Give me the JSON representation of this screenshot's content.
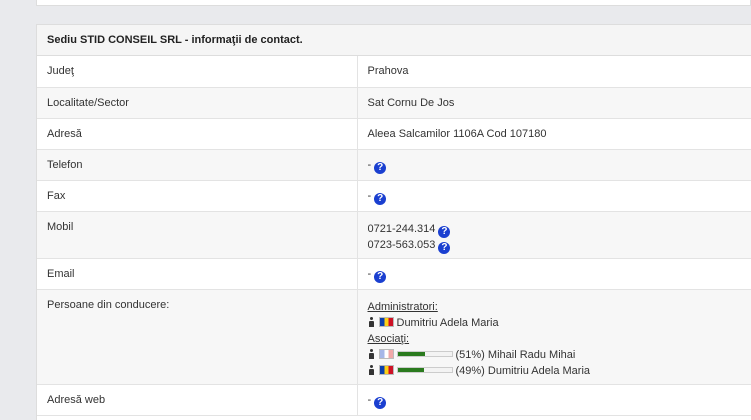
{
  "panel": {
    "title": "Sediu STID CONSEIL SRL - informaţii de contact."
  },
  "rows": {
    "judet": {
      "label": "Judeţ",
      "value": "Prahova"
    },
    "localitate": {
      "label": "Localitate/Sector",
      "value": "Sat Cornu De Jos"
    },
    "adresa": {
      "label": "Adresă",
      "value": "Aleea Salcamilor 1106A Cod 107180"
    },
    "telefon": {
      "label": "Telefon",
      "value": "-"
    },
    "fax": {
      "label": "Fax",
      "value": "-"
    },
    "mobil": {
      "label": "Mobil",
      "values": [
        "0721-244.314",
        "0723-563.053"
      ]
    },
    "email": {
      "label": "Email",
      "value": "-"
    },
    "persoane": {
      "label": "Persoane din conducere:",
      "administratori_label": "Administratori:",
      "administratori": [
        {
          "name": "Dumitriu Adela Maria",
          "flag": "romania"
        }
      ],
      "asociati_label": "Asociaţi:",
      "asociati": [
        {
          "share": "(51%)",
          "name": "Mihail Radu Mihai",
          "flag": "france",
          "fraction": 0.51
        },
        {
          "share": "(49%)",
          "name": "Dumitriu Adela Maria",
          "flag": "romania",
          "fraction": 0.49
        }
      ]
    },
    "adresa_web": {
      "label": "Adresă web",
      "value": "-"
    }
  },
  "help_icon": "question-circle-icon",
  "help_glyph": "?",
  "colors": {
    "help_icon": "#1a3fd0",
    "share_bar": "#2a7a1e"
  }
}
